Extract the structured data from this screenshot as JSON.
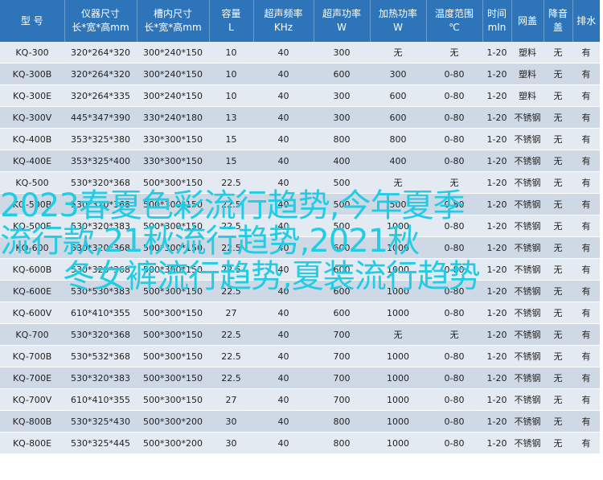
{
  "table": {
    "headers": [
      [
        "型  号"
      ],
      [
        "仪器尺寸",
        "长*宽*高mm"
      ],
      [
        "槽内尺寸",
        "长*宽*高mm"
      ],
      [
        "容量",
        "L"
      ],
      [
        "超声频率",
        "KHz"
      ],
      [
        "超声功率",
        "W"
      ],
      [
        "加热功率",
        "W"
      ],
      [
        "温度范围",
        "℃"
      ],
      [
        "时间",
        "mIn"
      ],
      [
        "网盖"
      ],
      [
        "降音盖"
      ],
      [
        "排水"
      ]
    ],
    "rows": [
      [
        "KQ-300",
        "320*264*320",
        "300*240*150",
        "10",
        "40",
        "300",
        "无",
        "无",
        "1-20",
        "塑料",
        "无",
        "有"
      ],
      [
        "KQ-300B",
        "320*264*320",
        "300*240*150",
        "10",
        "40",
        "600",
        "300",
        "0-80",
        "1-20",
        "塑料",
        "无",
        "有"
      ],
      [
        "KQ-300E",
        "320*264*335",
        "300*240*150",
        "10",
        "40",
        "300",
        "600",
        "0-80",
        "1-20",
        "塑料",
        "无",
        "有"
      ],
      [
        "KQ-300V",
        "445*347*390",
        "330*240*180",
        "13",
        "40",
        "300",
        "600",
        "0-80",
        "1-20",
        "不锈钢",
        "无",
        "有"
      ],
      [
        "KQ-400B",
        "353*325*380",
        "330*300*150",
        "15",
        "40",
        "800",
        "800",
        "0-80",
        "1-20",
        "不锈钢",
        "无",
        "有"
      ],
      [
        "KQ-400E",
        "353*325*400",
        "330*300*150",
        "15",
        "40",
        "400",
        "400",
        "0-80",
        "1-20",
        "不锈钢",
        "无",
        "有"
      ],
      [
        "KQ-500",
        "530*320*368",
        "500*300*150",
        "22.5",
        "40",
        "500",
        "无",
        "无",
        "1-20",
        "不锈钢",
        "无",
        "有"
      ],
      [
        "KQ-500B",
        "530*320*368",
        "500*300*150",
        "22.5",
        "40",
        "500",
        "500",
        "0-80",
        "1-20",
        "不锈钢",
        "无",
        "有"
      ],
      [
        "KQ-500E",
        "530*320*383",
        "500*300*150",
        "22.5",
        "40",
        "500",
        "1000",
        "0-80",
        "1-20",
        "不锈钢",
        "无",
        "有"
      ],
      [
        "KQ-600",
        "530*320*368",
        "500*300*150",
        "22.5",
        "40",
        "600",
        "1000",
        "0-80",
        "1-20",
        "不锈钢",
        "无",
        "有"
      ],
      [
        "KQ-600B",
        "530*320*368",
        "500*300*150",
        "22.5",
        "40",
        "600",
        "1000",
        "0-80",
        "1-20",
        "不锈钢",
        "无",
        "有"
      ],
      [
        "KQ-600E",
        "530*530*383",
        "500*300*150",
        "22.5",
        "40",
        "600",
        "1000",
        "0-80",
        "1-20",
        "不锈钢",
        "无",
        "有"
      ],
      [
        "KQ-600V",
        "610*410*355",
        "500*300*150",
        "27",
        "40",
        "600",
        "1000",
        "0-80",
        "1-20",
        "不锈钢",
        "无",
        "有"
      ],
      [
        "KQ-700",
        "530*320*368",
        "500*300*150",
        "22.5",
        "40",
        "700",
        "无",
        "无",
        "1-20",
        "不锈钢",
        "无",
        "有"
      ],
      [
        "KQ-700B",
        "530*532*368",
        "500*300*150",
        "22.5",
        "40",
        "700",
        "1000",
        "0-80",
        "1-20",
        "不锈钢",
        "无",
        "有"
      ],
      [
        "KQ-700E",
        "530*320*383",
        "500*300*150",
        "22.5",
        "40",
        "700",
        "1000",
        "0-80",
        "1-20",
        "不锈钢",
        "无",
        "有"
      ],
      [
        "KQ-700V",
        "610*410*355",
        "500*300*150",
        "27",
        "40",
        "700",
        "1000",
        "0-80",
        "1-20",
        "不锈钢",
        "无",
        "有"
      ],
      [
        "KQ-800B",
        "530*325*430",
        "500*300*200",
        "30",
        "40",
        "800",
        "1000",
        "0-80",
        "1-20",
        "不锈钢",
        "无",
        "有"
      ],
      [
        "KQ-800E",
        "530*325*445",
        "500*300*200",
        "30",
        "40",
        "800",
        "1000",
        "0-80",
        "1-20",
        "不锈钢",
        "无",
        "有"
      ]
    ]
  },
  "watermark": {
    "lines": [
      "2023春夏色彩流行趋势,今年夏季",
      "流行款,21秋流行趋势,2021秋",
      "冬女裤流行趋势,夏装流行趋势"
    ]
  }
}
